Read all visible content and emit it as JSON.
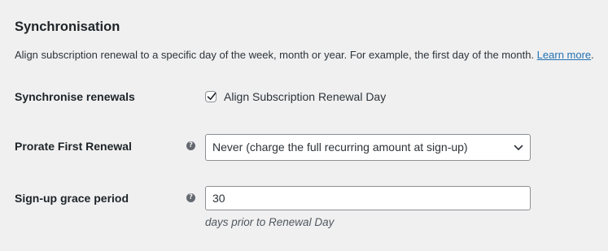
{
  "section": {
    "title": "Synchronisation",
    "description": "Align subscription renewal to a specific day of the week, month or year. For example, the first day of the month.",
    "learn_more": "Learn more",
    "learn_more_suffix": "."
  },
  "fields": {
    "synchronise": {
      "label": "Synchronise renewals",
      "checkbox_label": "Align Subscription Renewal Day",
      "checked": true
    },
    "prorate": {
      "label": "Prorate First Renewal",
      "help_icon": "help-icon",
      "selected_value": "Never (charge the full recurring amount at sign-up)"
    },
    "grace_period": {
      "label": "Sign-up grace period",
      "help_icon": "help-icon",
      "value": "30",
      "description": "days prior to Renewal Day"
    }
  },
  "colors": {
    "link": "#2271b1",
    "background": "#f0f0f1",
    "text": "#1d2327",
    "border": "#8c8f94",
    "help_icon": "#646970"
  }
}
